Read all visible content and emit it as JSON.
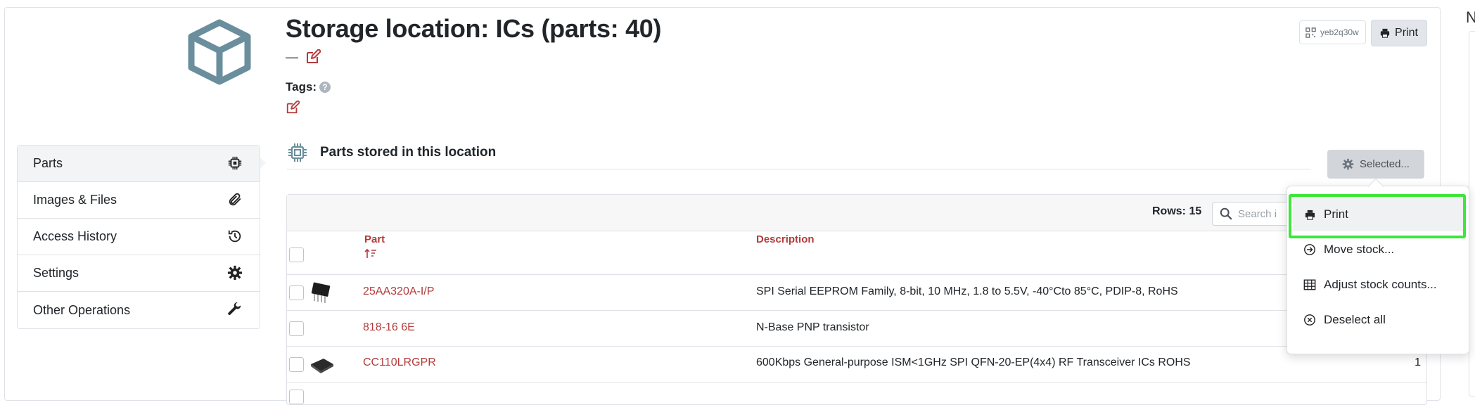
{
  "header": {
    "title": "Storage location: ICs (parts: 40)",
    "comment": "—",
    "tags_label": "Tags:",
    "qr_label": "yeb2q30w",
    "print_label": "Print"
  },
  "sidebar": {
    "items": [
      {
        "label": "Parts",
        "icon": "chip-icon"
      },
      {
        "label": "Images & Files",
        "icon": "paperclip-icon"
      },
      {
        "label": "Access History",
        "icon": "history-icon"
      },
      {
        "label": "Settings",
        "icon": "gear-icon"
      },
      {
        "label": "Other Operations",
        "icon": "wrench-icon"
      }
    ]
  },
  "section": {
    "title": "Parts stored in this location",
    "selected_label": "Selected..."
  },
  "table": {
    "rows_label": "Rows: 15",
    "search_placeholder": "Search i",
    "columns": [
      "Part",
      "Description"
    ],
    "rows": [
      {
        "part": "25AA320A-I/P",
        "description": "SPI Serial EEPROM Family, 8-bit, 10 MHz, 1.8 to 5.5V, -40°Cto 85°C, PDIP-8, RoHS",
        "qty": ""
      },
      {
        "part": "818-16 6E",
        "description": "N-Base PNP transistor",
        "qty": ""
      },
      {
        "part": "CC110LRGPR",
        "description": "600Kbps General-purpose ISM<1GHz SPI QFN-20-EP(4x4) RF Transceiver ICs ROHS",
        "qty": "1"
      }
    ]
  },
  "dropdown": {
    "items": [
      {
        "label": "Print",
        "icon": "printer-icon"
      },
      {
        "label": "Move stock...",
        "icon": "arrow-circle-icon"
      },
      {
        "label": "Adjust stock counts...",
        "icon": "grid-icon"
      },
      {
        "label": "Deselect all",
        "icon": "x-circle-icon"
      }
    ]
  },
  "colors": {
    "accent_link": "#b23b3b",
    "highlight": "#3ee63b",
    "icon_slate": "#6a8e9c"
  },
  "edge": {
    "letter": "N"
  }
}
